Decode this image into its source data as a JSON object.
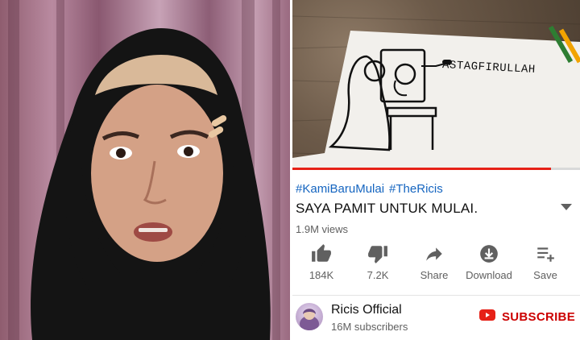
{
  "video": {
    "drawing_text": "ASTAGFIRULLAH",
    "progress": 0.9
  },
  "hashtags": [
    "#KamiBaruMulai",
    "#TheRicis"
  ],
  "title": "SAYA PAMIT UNTUK MULAI.",
  "views": "1.9M views",
  "actions": [
    {
      "label": "184K",
      "icon": "thumbs-up-icon"
    },
    {
      "label": "7.2K",
      "icon": "thumbs-down-icon"
    },
    {
      "label": "Share",
      "icon": "share-icon"
    },
    {
      "label": "Download",
      "icon": "download-icon"
    },
    {
      "label": "Save",
      "icon": "save-to-playlist-icon"
    }
  ],
  "channel": {
    "name": "Ricis Official",
    "subscribers": "16M subscribers"
  },
  "subscribe_label": "SUBSCRIBE",
  "colors": {
    "accent_red": "#cc0000",
    "link_blue": "#1565c0"
  }
}
